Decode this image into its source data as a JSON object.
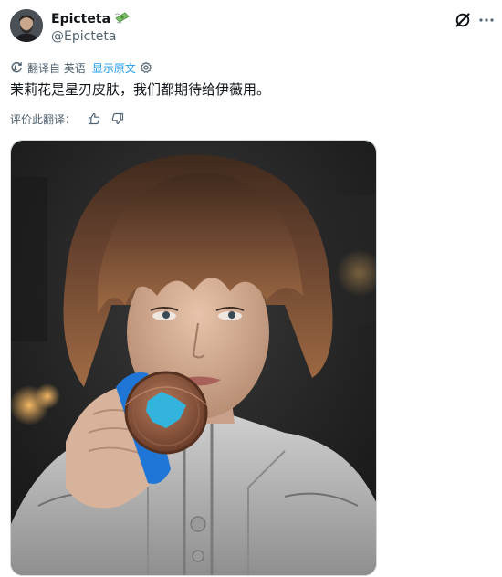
{
  "author": {
    "display_name": "Epicteta",
    "handle": "@Epicteta",
    "name_emoji": "money-with-wings-icon",
    "avatar_icon": "avatar-man-with-beard"
  },
  "header_actions": {
    "grok_icon": "grok-icon",
    "more_icon": "more-icon"
  },
  "translation": {
    "label": "翻译自 英语",
    "show_original": "显示原文",
    "settings_icon": "gear-icon"
  },
  "tweet": {
    "text": "茉莉花是星刃皮肤，我们都期待给伊薇用。"
  },
  "rate_translation": {
    "label": "评价此翻译：",
    "thumbs_up_icon": "thumbs-up-icon",
    "thumbs_down_icon": "thumbs-down-icon"
  },
  "media": {
    "kind": "photo",
    "subject": "photo-of-woman-biting-medal"
  },
  "colors": {
    "text_primary": "#0f1419",
    "text_secondary": "#536471",
    "accent": "#1d9bf0",
    "border": "#cfd9de"
  }
}
